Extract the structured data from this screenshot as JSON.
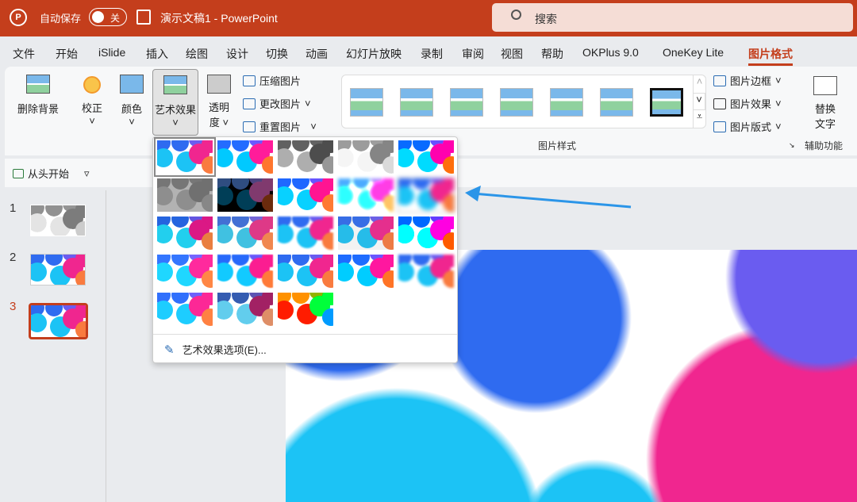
{
  "titlebar": {
    "app_icon": "P",
    "autosave_label": "自动保存",
    "toggle_state": "关",
    "document": "演示文稿1  -  PowerPoint",
    "search_placeholder": "搜索"
  },
  "tabs": [
    "文件",
    "开始",
    "iSlide",
    "插入",
    "绘图",
    "设计",
    "切换",
    "动画",
    "幻灯片放映",
    "录制",
    "审阅",
    "视图",
    "帮助",
    "OKPlus 9.0",
    "OneKey Lite",
    "图片格式"
  ],
  "active_tab": "图片格式",
  "ribbon": {
    "remove_bg": "删除背景",
    "corrections": "校正",
    "color": "颜色",
    "artistic": "艺术效果",
    "transparency": [
      "透明",
      "度"
    ],
    "compress": "压缩图片",
    "change": "更改图片",
    "reset": "重置图片",
    "group_styles": "图片样式",
    "border": "图片边框",
    "effects": "图片效果",
    "layout": "图片版式",
    "alt_text": [
      "替换",
      "文字"
    ],
    "group_access": "辅助功能"
  },
  "quickbar": {
    "from_start": "从头开始"
  },
  "slides": [
    {
      "number": "1"
    },
    {
      "number": "2"
    },
    {
      "number": "3"
    }
  ],
  "artistic_menu": {
    "options_label": "艺术效果选项(E)...",
    "selected_index": 0,
    "hovered_index": 9,
    "count": 23
  },
  "colors": {
    "accent": "#c43e1c",
    "blue": "#2f6bf0",
    "cyan": "#1cc3f5",
    "pink": "#f0268f",
    "orange": "#f97b3f",
    "purple": "#6a5cf0",
    "arrow": "#2b95e8"
  }
}
